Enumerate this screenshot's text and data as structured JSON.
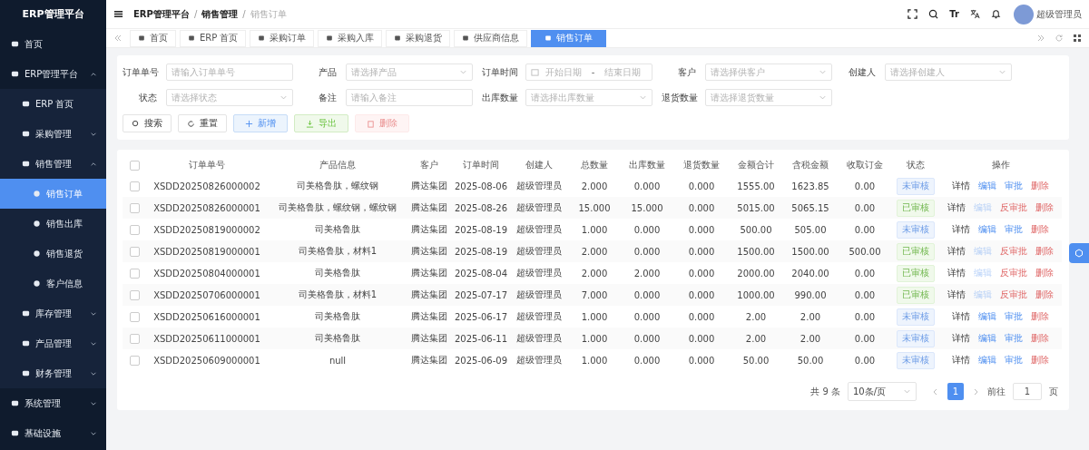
{
  "sidebar": {
    "title": "ERP管理平台",
    "items": [
      {
        "label": "首页",
        "selected": false
      },
      {
        "label": "ERP管理平台",
        "expanded": true,
        "selected": false,
        "children": [
          {
            "label": "ERP 首页",
            "selected": false
          },
          {
            "label": "采购管理",
            "expanded": false,
            "selected": false
          },
          {
            "label": "销售管理",
            "expanded": true,
            "selected": false,
            "children": [
              {
                "label": "销售订单",
                "selected": true
              },
              {
                "label": "销售出库",
                "selected": false
              },
              {
                "label": "销售退货",
                "selected": false
              },
              {
                "label": "客户信息",
                "selected": false
              }
            ]
          },
          {
            "label": "库存管理",
            "expanded": false,
            "selected": false
          },
          {
            "label": "产品管理",
            "expanded": false,
            "selected": false
          },
          {
            "label": "财务管理",
            "expanded": false,
            "selected": false
          }
        ]
      },
      {
        "label": "系统管理",
        "expanded": false,
        "selected": false
      },
      {
        "label": "基础设施",
        "expanded": false,
        "selected": false
      }
    ]
  },
  "header": {
    "breadcrumb": [
      "ERP管理平台",
      "销售管理",
      "销售订单"
    ],
    "breadcrumb_separators": [
      "/",
      "/"
    ],
    "font_size_glyph": "Tr",
    "user": "超级管理员"
  },
  "tabs": [
    {
      "label": "首页",
      "selected": false
    },
    {
      "label": "ERP 首页",
      "selected": false
    },
    {
      "label": "采购订单",
      "selected": false
    },
    {
      "label": "采购入库",
      "selected": false
    },
    {
      "label": "采购退货",
      "selected": false
    },
    {
      "label": "供应商信息",
      "selected": false
    },
    {
      "label": "销售订单",
      "selected": true
    }
  ],
  "filters": [
    {
      "label": "订单单号",
      "kind": "input",
      "placeholder": "请输入订单单号"
    },
    {
      "label": "产品",
      "kind": "select",
      "placeholder": "请选择产品"
    },
    {
      "label": "订单时间",
      "kind": "daterange",
      "placeholder": "开始日期",
      "placeholder_end": "结束日期",
      "separator": "-"
    },
    {
      "label": "客户",
      "kind": "select",
      "placeholder": "请选择供客户"
    },
    {
      "label": "创建人",
      "kind": "select",
      "placeholder": "请选择创建人"
    },
    {
      "label": "状态",
      "kind": "select",
      "placeholder": "请选择状态"
    },
    {
      "label": "备注",
      "kind": "input",
      "placeholder": "请输入备注"
    },
    {
      "label": "出库数量",
      "kind": "select",
      "placeholder": "请选择出库数量"
    },
    {
      "label": "退货数量",
      "kind": "select",
      "placeholder": "请选择退货数量"
    }
  ],
  "buttons": [
    {
      "label": "搜索",
      "kind": "search",
      "disabled": false
    },
    {
      "label": "重置",
      "kind": "reset",
      "disabled": false
    },
    {
      "label": "新增",
      "kind": "add",
      "disabled": false
    },
    {
      "label": "导出",
      "kind": "export",
      "disabled": false
    },
    {
      "label": "删除",
      "kind": "delete",
      "disabled": true
    }
  ],
  "table": {
    "header_checked": false,
    "columns": [
      "订单单号",
      "产品信息",
      "客户",
      "订单时间",
      "创建人",
      "总数量",
      "出库数量",
      "退货数量",
      "金额合计",
      "含税金额",
      "收取订金",
      "状态",
      "操作"
    ],
    "rows": [
      {
        "checked": false,
        "cells": [
          "XSDD20250826000002",
          "司美格鲁肽，螺纹钢",
          "腾达集团",
          "2025-08-06",
          "超级管理员",
          "2.000",
          "0.000",
          "0.000",
          "1555.00",
          "1623.85",
          "0.00"
        ],
        "status": {
          "text": "未审核",
          "approved": false
        },
        "actions": [
          {
            "label": "详情",
            "kind": "detail",
            "disabled": false
          },
          {
            "label": "编辑",
            "kind": "edit",
            "disabled": false
          },
          {
            "label": "审批",
            "kind": "approve",
            "disabled": false
          },
          {
            "label": "删除",
            "kind": "delete",
            "disabled": false
          }
        ]
      },
      {
        "checked": false,
        "cells": [
          "XSDD20250826000001",
          "司美格鲁肽，螺纹钢，螺纹钢",
          "腾达集团",
          "2025-08-26",
          "超级管理员",
          "15.000",
          "15.000",
          "0.000",
          "5015.00",
          "5065.15",
          "0.00"
        ],
        "status": {
          "text": "已审核",
          "approved": true
        },
        "actions": [
          {
            "label": "详情",
            "kind": "detail",
            "disabled": false
          },
          {
            "label": "编辑",
            "kind": "edit",
            "disabled": true
          },
          {
            "label": "反审批",
            "kind": "unapprove",
            "disabled": false
          },
          {
            "label": "删除",
            "kind": "delete",
            "disabled": false
          }
        ]
      },
      {
        "checked": false,
        "cells": [
          "XSDD20250819000002",
          "司美格鲁肽",
          "腾达集团",
          "2025-08-19",
          "超级管理员",
          "1.000",
          "0.000",
          "0.000",
          "500.00",
          "505.00",
          "0.00"
        ],
        "status": {
          "text": "未审核",
          "approved": false
        },
        "actions": [
          {
            "label": "详情",
            "kind": "detail",
            "disabled": false
          },
          {
            "label": "编辑",
            "kind": "edit",
            "disabled": false
          },
          {
            "label": "审批",
            "kind": "approve",
            "disabled": false
          },
          {
            "label": "删除",
            "kind": "delete",
            "disabled": false
          }
        ]
      },
      {
        "checked": false,
        "cells": [
          "XSDD20250819000001",
          "司美格鲁肽，材料1",
          "腾达集团",
          "2025-08-19",
          "超级管理员",
          "2.000",
          "0.000",
          "0.000",
          "1500.00",
          "1500.00",
          "500.00"
        ],
        "status": {
          "text": "已审核",
          "approved": true
        },
        "actions": [
          {
            "label": "详情",
            "kind": "detail",
            "disabled": false
          },
          {
            "label": "编辑",
            "kind": "edit",
            "disabled": true
          },
          {
            "label": "反审批",
            "kind": "unapprove",
            "disabled": false
          },
          {
            "label": "删除",
            "kind": "delete",
            "disabled": false
          }
        ]
      },
      {
        "checked": false,
        "cells": [
          "XSDD20250804000001",
          "司美格鲁肽",
          "腾达集团",
          "2025-08-04",
          "超级管理员",
          "2.000",
          "2.000",
          "0.000",
          "2000.00",
          "2040.00",
          "0.00"
        ],
        "status": {
          "text": "已审核",
          "approved": true
        },
        "actions": [
          {
            "label": "详情",
            "kind": "detail",
            "disabled": false
          },
          {
            "label": "编辑",
            "kind": "edit",
            "disabled": true
          },
          {
            "label": "反审批",
            "kind": "unapprove",
            "disabled": false
          },
          {
            "label": "删除",
            "kind": "delete",
            "disabled": false
          }
        ]
      },
      {
        "checked": false,
        "cells": [
          "XSDD20250706000001",
          "司美格鲁肽，材料1",
          "腾达集团",
          "2025-07-17",
          "超级管理员",
          "7.000",
          "0.000",
          "0.000",
          "1000.00",
          "990.00",
          "0.00"
        ],
        "status": {
          "text": "已审核",
          "approved": true
        },
        "actions": [
          {
            "label": "详情",
            "kind": "detail",
            "disabled": false
          },
          {
            "label": "编辑",
            "kind": "edit",
            "disabled": true
          },
          {
            "label": "反审批",
            "kind": "unapprove",
            "disabled": false
          },
          {
            "label": "删除",
            "kind": "delete",
            "disabled": false
          }
        ]
      },
      {
        "checked": false,
        "cells": [
          "XSDD20250616000001",
          "司美格鲁肽",
          "腾达集团",
          "2025-06-17",
          "超级管理员",
          "1.000",
          "0.000",
          "0.000",
          "2.00",
          "2.00",
          "0.00"
        ],
        "status": {
          "text": "未审核",
          "approved": false
        },
        "actions": [
          {
            "label": "详情",
            "kind": "detail",
            "disabled": false
          },
          {
            "label": "编辑",
            "kind": "edit",
            "disabled": false
          },
          {
            "label": "审批",
            "kind": "approve",
            "disabled": false
          },
          {
            "label": "删除",
            "kind": "delete",
            "disabled": false
          }
        ]
      },
      {
        "checked": false,
        "cells": [
          "XSDD20250611000001",
          "司美格鲁肽",
          "腾达集团",
          "2025-06-11",
          "超级管理员",
          "1.000",
          "0.000",
          "0.000",
          "2.00",
          "2.00",
          "0.00"
        ],
        "status": {
          "text": "未审核",
          "approved": false
        },
        "actions": [
          {
            "label": "详情",
            "kind": "detail",
            "disabled": false
          },
          {
            "label": "编辑",
            "kind": "edit",
            "disabled": false
          },
          {
            "label": "审批",
            "kind": "approve",
            "disabled": false
          },
          {
            "label": "删除",
            "kind": "delete",
            "disabled": false
          }
        ]
      },
      {
        "checked": false,
        "cells": [
          "XSDD20250609000001",
          "null",
          "腾达集团",
          "2025-06-09",
          "超级管理员",
          "1.000",
          "0.000",
          "0.000",
          "50.00",
          "50.00",
          "0.00"
        ],
        "status": {
          "text": "未审核",
          "approved": false
        },
        "actions": [
          {
            "label": "详情",
            "kind": "detail",
            "disabled": false
          },
          {
            "label": "编辑",
            "kind": "edit",
            "disabled": false
          },
          {
            "label": "审批",
            "kind": "approve",
            "disabled": false
          },
          {
            "label": "删除",
            "kind": "delete",
            "disabled": false
          }
        ]
      }
    ]
  },
  "pagination": {
    "total": "共 9 条",
    "page_size": "10条/页",
    "pages": [
      {
        "label": "1",
        "selected": true
      }
    ],
    "goto_label": "前往",
    "goto_value": "1",
    "goto_suffix": "页"
  }
}
